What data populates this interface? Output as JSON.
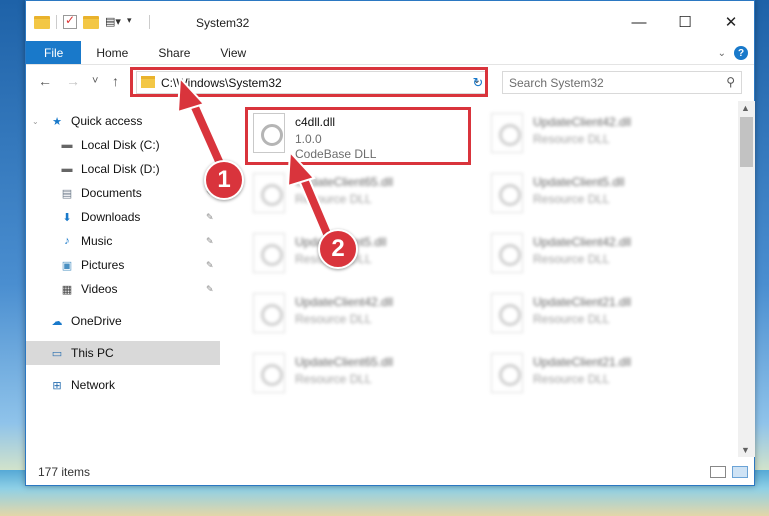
{
  "window": {
    "title": "System32",
    "controls": {
      "minimize": "—",
      "maximize": "☐",
      "close": "✕"
    }
  },
  "ribbon": {
    "tabs": [
      "File",
      "Home",
      "Share",
      "View"
    ],
    "help_icon": "?"
  },
  "nav": {
    "back_icon": "←",
    "forward_icon": "→",
    "recent_icon": "˅",
    "up_icon": "↑",
    "address": "C:\\Windows\\System32",
    "refresh_icon": "↻",
    "search_placeholder": "Search System32",
    "search_icon": "⚲"
  },
  "sidebar": {
    "items": [
      {
        "label": "Quick access",
        "icon": "star-icon",
        "glyph": "★"
      },
      {
        "label": "Local Disk (C:)",
        "icon": "drive-icon",
        "glyph": "▬"
      },
      {
        "label": "Local Disk (D:)",
        "icon": "drive-icon",
        "glyph": "▬"
      },
      {
        "label": "Documents",
        "icon": "document-icon",
        "glyph": "▤"
      },
      {
        "label": "Downloads",
        "icon": "download-icon",
        "glyph": "⬇"
      },
      {
        "label": "Music",
        "icon": "music-icon",
        "glyph": "♪"
      },
      {
        "label": "Pictures",
        "icon": "pictures-icon",
        "glyph": "▣"
      },
      {
        "label": "Videos",
        "icon": "video-icon",
        "glyph": "▦"
      },
      {
        "label": "OneDrive",
        "icon": "cloud-icon",
        "glyph": "☁"
      },
      {
        "label": "This PC",
        "icon": "computer-icon",
        "glyph": "▭"
      },
      {
        "label": "Network",
        "icon": "network-icon",
        "glyph": "⊞"
      }
    ],
    "pin_icon": "📌"
  },
  "files": {
    "highlighted": {
      "name": "c4dll.dll",
      "version": "1.0.0",
      "type": "CodeBase DLL"
    },
    "others": [
      {
        "name": "UpdateClient42.dll",
        "type": "Resource DLL"
      },
      {
        "name": "UpdateClient65.dll",
        "type": "Resource DLL"
      },
      {
        "name": "UpdateClient5.dll",
        "type": "Resource DLL"
      },
      {
        "name": "UpdateClient5.dll",
        "type": "Resource DLL"
      },
      {
        "name": "UpdateClient42.dll",
        "type": "Resource DLL"
      },
      {
        "name": "UpdateClient42.dll",
        "type": "Resource DLL"
      },
      {
        "name": "UpdateClient21.dll",
        "type": "Resource DLL"
      },
      {
        "name": "UpdateClient65.dll",
        "type": "Resource DLL"
      },
      {
        "name": "UpdateClient21.dll",
        "type": "Resource DLL"
      }
    ]
  },
  "status": {
    "item_count": "177 items"
  },
  "annotations": {
    "step1": "1",
    "step2": "2"
  },
  "colors": {
    "accent": "#1979ca",
    "highlight": "#d9343c"
  }
}
